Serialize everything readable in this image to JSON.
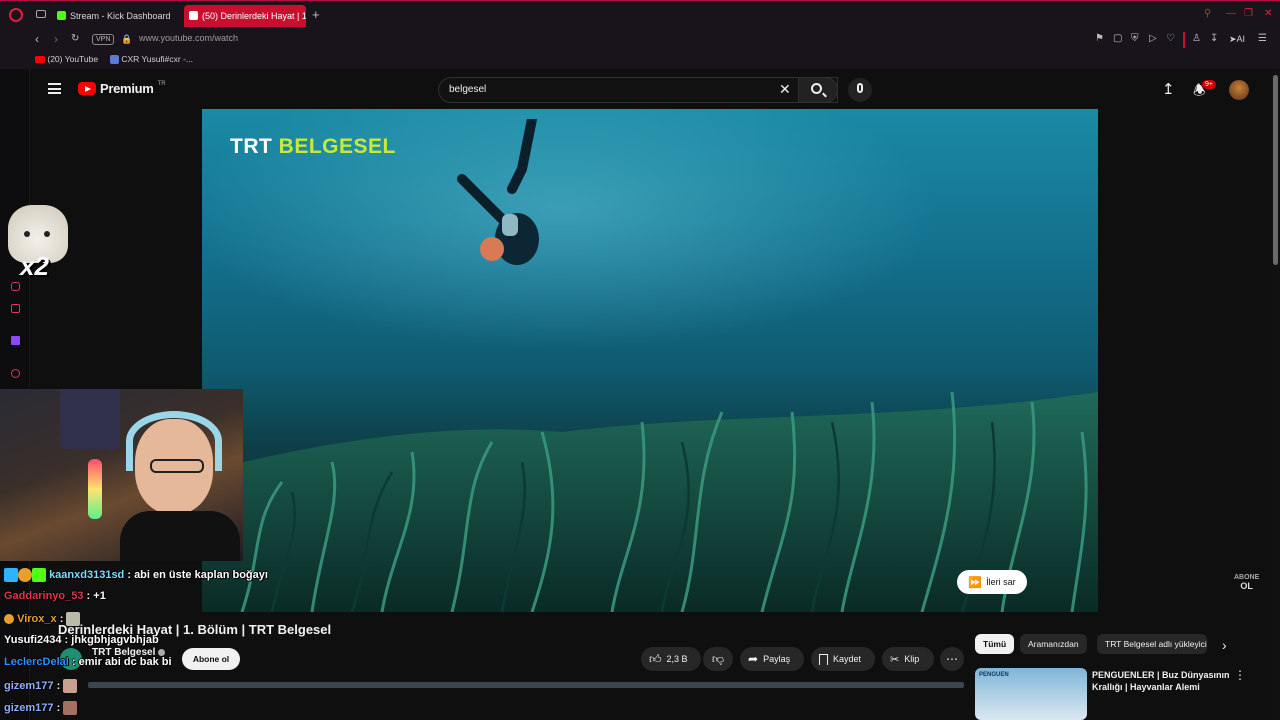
{
  "browser": {
    "tabs": [
      {
        "label": "Stream - Kick Dashboard",
        "favicon_color": "#53fc18"
      },
      {
        "label": "(50) Derinlerdeki Hayat | 1",
        "favicon_color": "#ff0000"
      }
    ],
    "vpn_label": "VPN",
    "url": "www.youtube.com/watch",
    "bookmarks": [
      {
        "label": "(20) YouTube"
      },
      {
        "label": "CXR Yusufi#cxr -..."
      }
    ],
    "ai_label": "AI"
  },
  "youtube": {
    "logo_text": "Premium",
    "logo_region": "TR",
    "search_query": "belgesel",
    "notification_count": "9+",
    "video": {
      "channel_watermark_white": "TRT ",
      "channel_watermark_green": "BELGESEL",
      "skip_label": "İleri sar",
      "subscribe_watermark_line1": "ABONE",
      "subscribe_watermark_line2": "OL",
      "title": "Derinlerdeki Hayat | 1. Bölüm | TRT Belgesel",
      "channel_name": "TRT Belgesel",
      "subscribe_label": "Abone ol",
      "like_count": "2,3 B",
      "share_label": "Paylaş",
      "save_label": "Kaydet",
      "clip_label": "Klip"
    },
    "chips": [
      "Tümü",
      "Aramanızdan",
      "TRT Belgesel adlı yükleyici"
    ],
    "recommendation": {
      "title_line1": "PENGUENLER | Buz Dünyasının",
      "title_line2": "Krallığı | Hayvanlar Alemi",
      "thumb_label": "PENGUEN"
    }
  },
  "stream_overlay": {
    "emote_label": "x2",
    "chat": [
      {
        "user": "kaanxd3131sd",
        "message": ": abi en üste kaplan boğayı",
        "color": "#7fdcff"
      },
      {
        "user": "Gaddarinyo_53",
        "message": ": +1",
        "color": "#e0354a"
      },
      {
        "user": "Virox_x",
        "message": ":",
        "color": "#e6a02b"
      },
      {
        "user": "Yusufi2434",
        "message": ": jhkgbhjagvbhjab",
        "color": "#ffffff"
      },
      {
        "user": "LeclercDelal",
        "message": ": emir abi dc bak bi",
        "color": "#2f8fff"
      },
      {
        "user": "gizem177",
        "message": ":",
        "color": "#8fb0ff"
      },
      {
        "user": "gizem177",
        "message": ":",
        "color": "#8fb0ff"
      }
    ]
  }
}
